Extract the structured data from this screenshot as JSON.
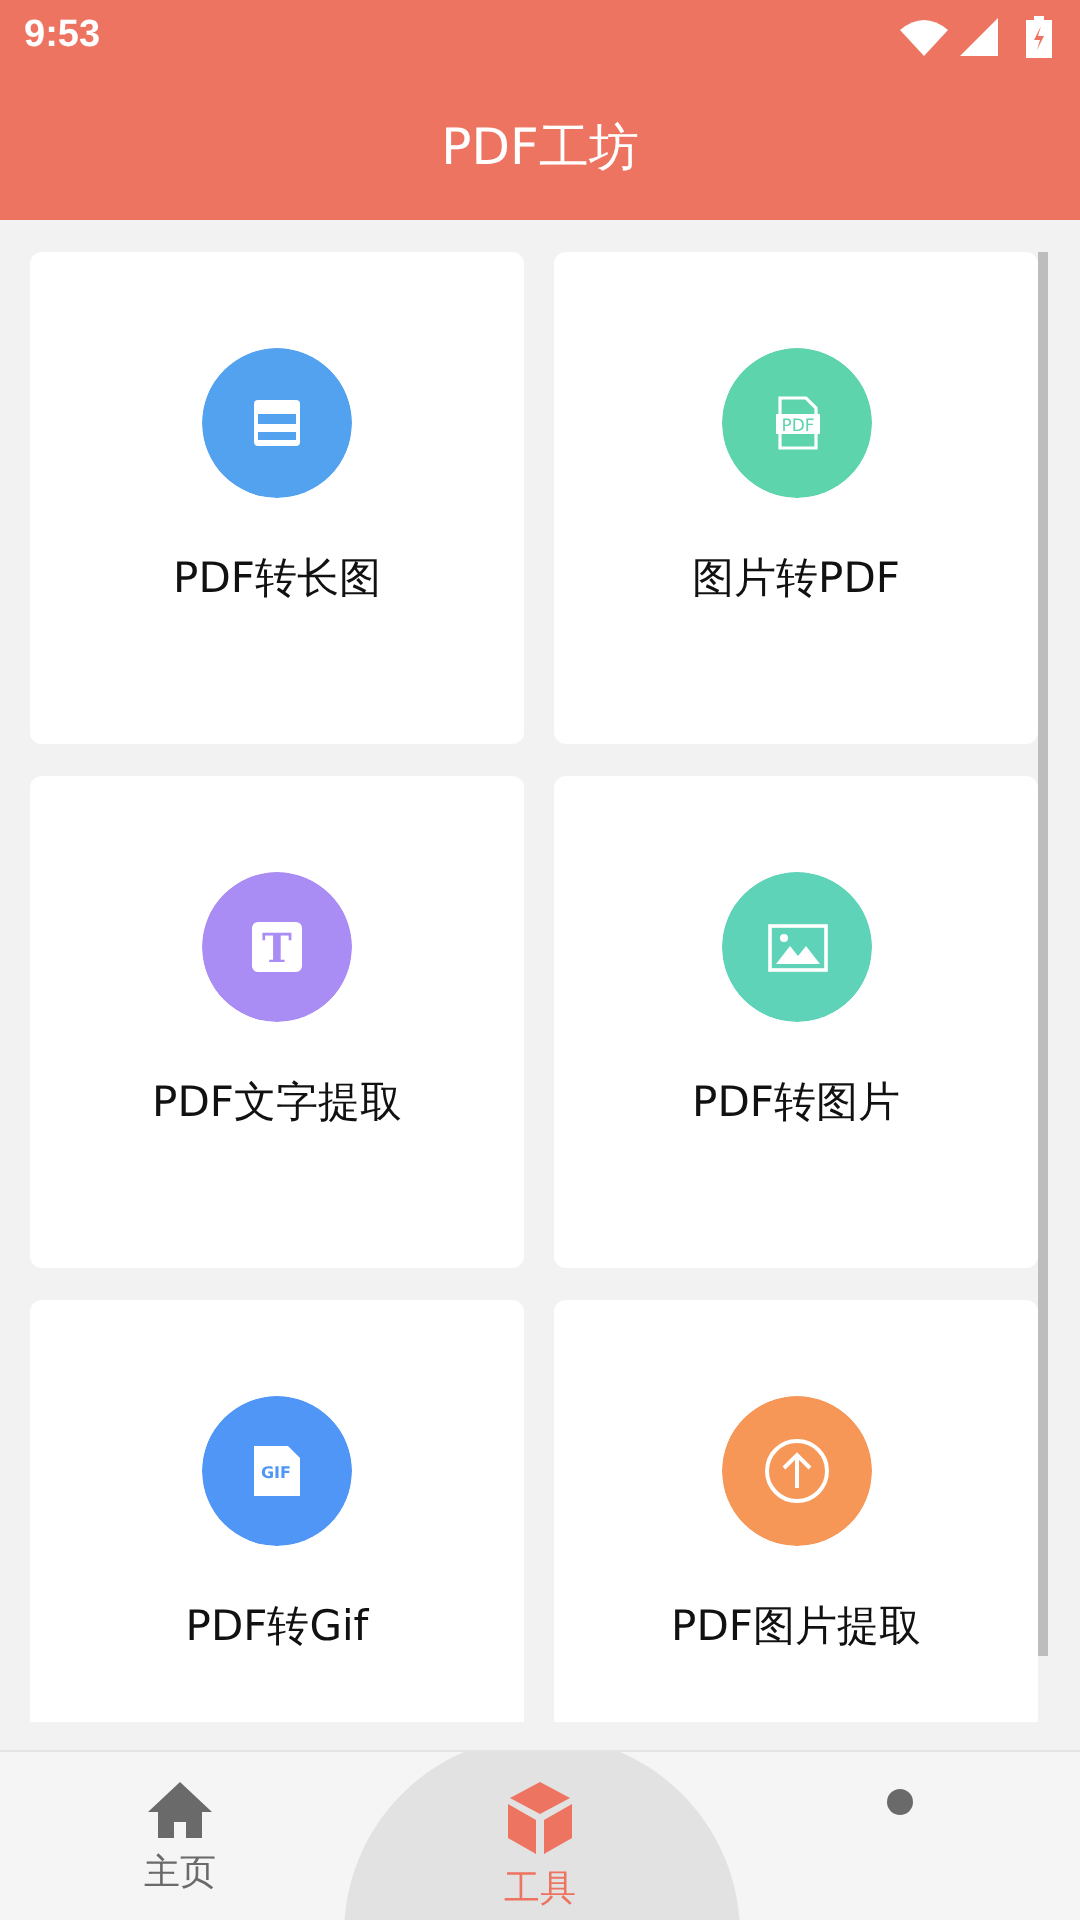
{
  "status_bar": {
    "time": "9:53"
  },
  "title": "PDF工坊",
  "tools": [
    {
      "label": "PDF转长图",
      "kind": "long",
      "color": "#52a2f0"
    },
    {
      "label": "图片转PDF",
      "kind": "pdf",
      "color": "#5dd4ab",
      "icon_text": "PDF"
    },
    {
      "label": "PDF文字提取",
      "kind": "text",
      "color": "#a98cf4",
      "icon_text": "T"
    },
    {
      "label": "PDF转图片",
      "kind": "image",
      "color": "#5ed3b7"
    },
    {
      "label": "PDF转Gif",
      "kind": "gif",
      "color": "#4f96f6",
      "icon_text": "GIF"
    },
    {
      "label": "PDF图片提取",
      "kind": "upload",
      "color": "#f69657"
    }
  ],
  "nav": [
    {
      "kind": "home",
      "label": "主页",
      "selected": false
    },
    {
      "kind": "tools",
      "label": "工具",
      "selected": true
    },
    {
      "kind": "dot",
      "selected": false
    }
  ]
}
